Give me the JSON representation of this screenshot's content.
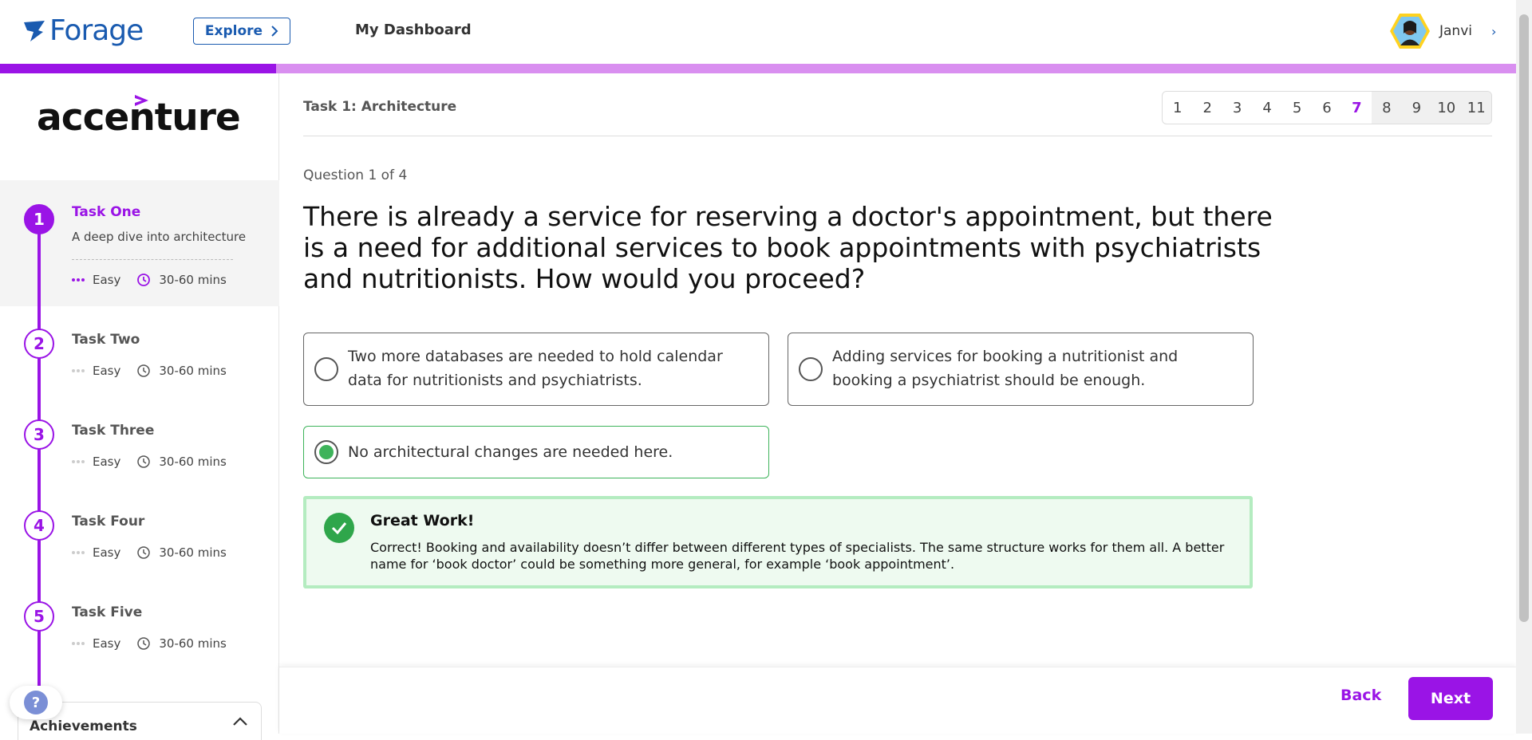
{
  "nav": {
    "logo_text": "Forage",
    "explore_label": "Explore",
    "dashboard_label": "My Dashboard",
    "user_name": "Janvi"
  },
  "progress": {
    "fraction": 0.182,
    "fill_color": "#9a14e6",
    "track_color": "#d98ff0"
  },
  "sidebar": {
    "brand": "accenture",
    "tasks": [
      {
        "num": "1",
        "title": "Task One",
        "desc": "A deep dive into architecture",
        "difficulty": "Easy",
        "duration": "30-60 mins",
        "active": true
      },
      {
        "num": "2",
        "title": "Task Two",
        "difficulty": "Easy",
        "duration": "30-60 mins"
      },
      {
        "num": "3",
        "title": "Task Three",
        "difficulty": "Easy",
        "duration": "30-60 mins"
      },
      {
        "num": "4",
        "title": "Task Four",
        "difficulty": "Easy",
        "duration": "30-60 mins"
      },
      {
        "num": "5",
        "title": "Task Five",
        "difficulty": "Easy",
        "duration": "30-60 mins"
      }
    ],
    "help_label": "?",
    "achievements_label": "Achievements"
  },
  "main": {
    "breadcrumb": "Task 1: Architecture",
    "pages": [
      "1",
      "2",
      "3",
      "4",
      "5",
      "6",
      "7",
      "8",
      "9",
      "10",
      "11"
    ],
    "current_page": "7",
    "question_count": "Question 1 of 4",
    "question": "There is already a service for reserving a doctor's appointment, but there is a need for additional services to book appointments with psychiatrists and nutritionists. How would you proceed?",
    "options": [
      {
        "text": "Two more databases are needed to hold calendar data for nutritionists and psychiatrists."
      },
      {
        "text": "Adding services for booking a nutritionist and booking a psychiatrist should be enough."
      },
      {
        "text": "No architectural changes are needed here.",
        "selected": true
      }
    ],
    "feedback": {
      "title": "Great Work!",
      "body": "Correct! Booking and availability doesn’t differ between different types of specialists. The same structure works for them all. A better name for ‘book doctor’ could be something more general, for example ‘book appointment’."
    },
    "back_label": "Back",
    "next_label": "Next"
  },
  "colors": {
    "accent": "#9a14e6",
    "brand_blue": "#1a5bb0",
    "success": "#2fa64b"
  }
}
